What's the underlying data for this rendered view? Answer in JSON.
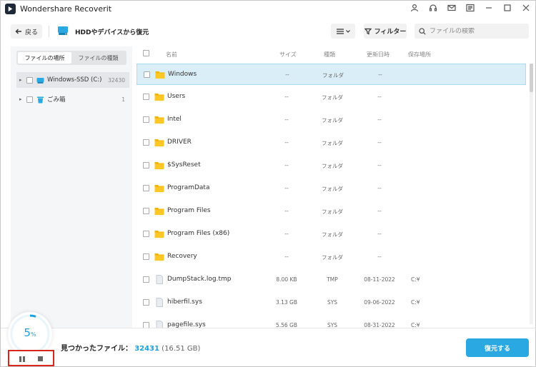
{
  "app": {
    "title": "Wondershare Recoverit",
    "colors": {
      "accent": "#2aa8e2",
      "progress": "#1aa0dc",
      "highlight": "#d9261c",
      "folder": "#f5b400"
    },
    "window_icons": [
      "user-icon",
      "headset-icon",
      "mail-icon",
      "settings-icon",
      "minimize-icon",
      "maximize-icon",
      "close-icon"
    ]
  },
  "toolbar": {
    "back_label": "戻る",
    "location_title": "HDDやデバイスから復元",
    "filter_label": "フィルター",
    "search_placeholder": "ファイルの検索"
  },
  "left_panel": {
    "tabs": [
      {
        "label": "ファイルの場所",
        "active": true
      },
      {
        "label": "ファイルの種類",
        "active": false
      }
    ],
    "tree": [
      {
        "label": "Windows-SSD (C:)",
        "count": "32430",
        "icon": "drive-icon"
      },
      {
        "label": "ごみ箱",
        "count": "1",
        "icon": "trash-icon"
      }
    ]
  },
  "file_list": {
    "columns": {
      "name": "名前",
      "size": "サイズ",
      "type": "種類",
      "date": "更新日時",
      "location": "保存場所"
    },
    "rows": [
      {
        "name": "Windows",
        "size": "--",
        "type": "フォルダ",
        "date": "--",
        "location": "",
        "icon": "folder-icon"
      },
      {
        "name": "Users",
        "size": "--",
        "type": "フォルダ",
        "date": "--",
        "location": "",
        "icon": "folder-icon"
      },
      {
        "name": "Intel",
        "size": "--",
        "type": "フォルダ",
        "date": "--",
        "location": "",
        "icon": "folder-icon"
      },
      {
        "name": "DRIVER",
        "size": "--",
        "type": "フォルダ",
        "date": "--",
        "location": "",
        "icon": "folder-icon"
      },
      {
        "name": "$SysReset",
        "size": "--",
        "type": "フォルダ",
        "date": "--",
        "location": "",
        "icon": "folder-icon"
      },
      {
        "name": "ProgramData",
        "size": "--",
        "type": "フォルダ",
        "date": "--",
        "location": "",
        "icon": "folder-icon"
      },
      {
        "name": "Program Files",
        "size": "--",
        "type": "フォルダ",
        "date": "--",
        "location": "",
        "icon": "folder-icon"
      },
      {
        "name": "Program Files (x86)",
        "size": "--",
        "type": "フォルダ",
        "date": "--",
        "location": "",
        "icon": "folder-icon"
      },
      {
        "name": "Recovery",
        "size": "--",
        "type": "フォルダ",
        "date": "--",
        "location": "",
        "icon": "folder-icon"
      },
      {
        "name": "DumpStack.log.tmp",
        "size": "8.00 KB",
        "type": "TMP",
        "date": "08-11-2022",
        "location": "C:¥",
        "icon": "file-icon"
      },
      {
        "name": "hiberfil.sys",
        "size": "3.13 GB",
        "type": "SYS",
        "date": "09-06-2022",
        "location": "C:¥",
        "icon": "file-icon"
      },
      {
        "name": "pagefile.sys",
        "size": "5.56 GB",
        "type": "SYS",
        "date": "08-31-2022",
        "location": "C:¥",
        "icon": "file-icon"
      }
    ]
  },
  "status": {
    "progress_value": "5",
    "progress_unit": "%",
    "progress_fraction": 0.05,
    "found_label": "見つかったファイル：",
    "found_count": "32431",
    "found_size": "(16.51 GB)",
    "recover_label": "復元する"
  }
}
